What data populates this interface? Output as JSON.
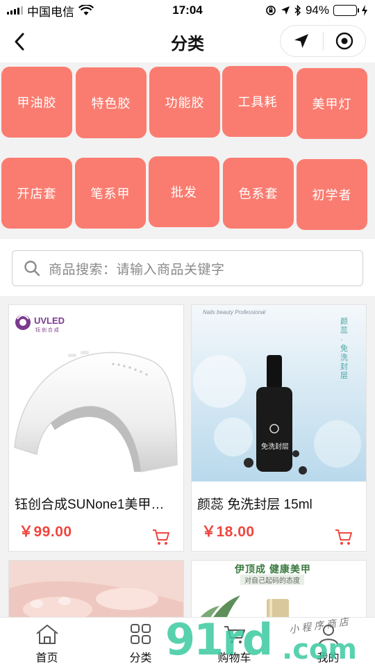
{
  "status_bar": {
    "carrier": "中国电信",
    "time": "17:04",
    "battery": "94%",
    "battery_level": 0.94
  },
  "nav": {
    "title": "分类"
  },
  "categories": [
    "甲油胶",
    "特色胶",
    "功能胶",
    "工具耗",
    "美甲灯",
    "开店套",
    "笔系甲",
    "批发",
    "色系套",
    "初学者"
  ],
  "search": {
    "placeholder": "商品搜索：请输入商品关键字"
  },
  "products": [
    {
      "name": "钰创合成SUNone1美甲…",
      "price": "￥99.00",
      "brand_label": "UVLED",
      "brand_sub": "钰 创 合 成"
    },
    {
      "name": "颜蕊 免洗封层 15ml",
      "price": "￥18.00",
      "top_text": "Nails beauty Professional",
      "side_text": "颜蕊·免洗封层",
      "bottle_text": "免洗封层"
    },
    {
      "name": "",
      "price": ""
    },
    {
      "name": "",
      "price": "",
      "banner_title": "伊顶成 健康美甲",
      "banner_sub": "对自己起码的态度"
    }
  ],
  "tabs": [
    {
      "label": "首页",
      "icon": "home-icon"
    },
    {
      "label": "分类",
      "icon": "grid-icon"
    },
    {
      "label": "购物车",
      "icon": "cart-icon"
    },
    {
      "label": "我的",
      "icon": "person-icon"
    }
  ],
  "watermark": {
    "text": "91rd",
    "domain": ".com",
    "script": "小程序商店"
  },
  "colors": {
    "category_bg": "#fa7c70",
    "price": "#f0453d",
    "battery": "#4cd964",
    "watermark_green": "#3cc9a0"
  }
}
